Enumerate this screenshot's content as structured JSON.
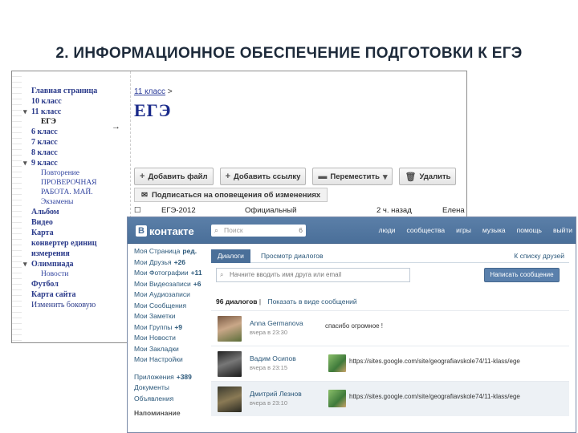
{
  "slide_title": "2. ИНФОРМАЦИОННОЕ ОБЕСПЕЧЕНИЕ ПОДГОТОВКИ К ЕГЭ",
  "site": {
    "nav": [
      {
        "label": "Главная страница",
        "type": "bold"
      },
      {
        "label": "10 класс",
        "type": "bold"
      },
      {
        "label": "11 класс",
        "type": "bold tri"
      },
      {
        "label": "ЕГЭ",
        "type": "sub current"
      },
      {
        "label": "6 класс",
        "type": "bold"
      },
      {
        "label": "7 класс",
        "type": "bold"
      },
      {
        "label": "8 класс",
        "type": "bold"
      },
      {
        "label": "9 класс",
        "type": "bold tri"
      },
      {
        "label": "Повторение",
        "type": "sub"
      },
      {
        "label": "ПРОВЕРОЧНАЯ",
        "type": "sub"
      },
      {
        "label": "РАБОТА. МАЙ.",
        "type": "sub"
      },
      {
        "label": "Экзамены",
        "type": "sub"
      },
      {
        "label": "Альбом",
        "type": "bold"
      },
      {
        "label": "Видео",
        "type": "bold"
      },
      {
        "label": "Карта",
        "type": "bold"
      },
      {
        "label": "конвертер единиц",
        "type": "bold"
      },
      {
        "label": "измерения",
        "type": "bold"
      },
      {
        "label": "Олимпиада",
        "type": "bold tri"
      },
      {
        "label": "Новости",
        "type": "sub"
      },
      {
        "label": "Футбол",
        "type": "bold"
      },
      {
        "label": "Карта сайта",
        "type": "bold"
      },
      {
        "label": "Изменить боковую",
        "type": "plain"
      }
    ],
    "side_arrow": "→",
    "breadcrumb": {
      "link": "11 класс",
      "sep": ">"
    },
    "page_title": "ЕГЭ",
    "toolbar": {
      "add_file": "Добавить файл",
      "add_link": "Добавить ссылку",
      "move": "Переместить",
      "delete": "Удалить"
    },
    "subscribe": "Подписаться на оповещения об изменениях",
    "file_row": {
      "name": "ЕГЭ-2012",
      "type": "Официальный",
      "time": "2 ч. назад",
      "author": "Елена"
    }
  },
  "vk": {
    "logo_letter": "В",
    "logo_text": "контакте",
    "search_placeholder": "Поиск",
    "search_count": "6",
    "menu": [
      "люди",
      "сообщества",
      "игры",
      "музыка",
      "помощь",
      "выйти"
    ],
    "sidebar": [
      {
        "label": "Моя Страница",
        "extra": "ред."
      },
      {
        "label": "Мои Друзья",
        "extra": "+26"
      },
      {
        "label": "Мои Фотографии",
        "extra": "+11"
      },
      {
        "label": "Мои Видеозаписи",
        "extra": "+6"
      },
      {
        "label": "Мои Аудиозаписи",
        "extra": ""
      },
      {
        "label": "Мои Сообщения",
        "extra": ""
      },
      {
        "label": "Мои Заметки",
        "extra": ""
      },
      {
        "label": "Мои Группы",
        "extra": "+9"
      },
      {
        "label": "Мои Новости",
        "extra": ""
      },
      {
        "label": "Мои Закладки",
        "extra": ""
      },
      {
        "label": "Мои Настройки",
        "extra": ""
      }
    ],
    "sidebar_bottom": [
      {
        "label": "Приложения",
        "extra": "+389"
      },
      {
        "label": "Документы",
        "extra": ""
      },
      {
        "label": "Объявления",
        "extra": ""
      }
    ],
    "reminder": "Напоминание",
    "tabs": {
      "dialogs": "Диалоги",
      "view": "Просмотр диалогов"
    },
    "back_link": "К списку друзей",
    "find_placeholder": "Начните вводить имя друга или email",
    "write_button": "Написать сообщение",
    "count_text": "96 диалогов",
    "show_as_messages": "Показать в виде сообщений",
    "dialogs": [
      {
        "name": "Anna Germanova",
        "time": "вчера в 23:30",
        "message": "спасибо огромное !"
      },
      {
        "name": "Вадим Осипов",
        "time": "вчера в 23:15",
        "message": "https://sites.google.com/site/geografiavskole74/11-klass/ege"
      },
      {
        "name": "Дмитрий Лезнов",
        "time": "вчера в 23:10",
        "message": "https://sites.google.com/site/geografiavskole74/11-klass/ege"
      }
    ]
  }
}
